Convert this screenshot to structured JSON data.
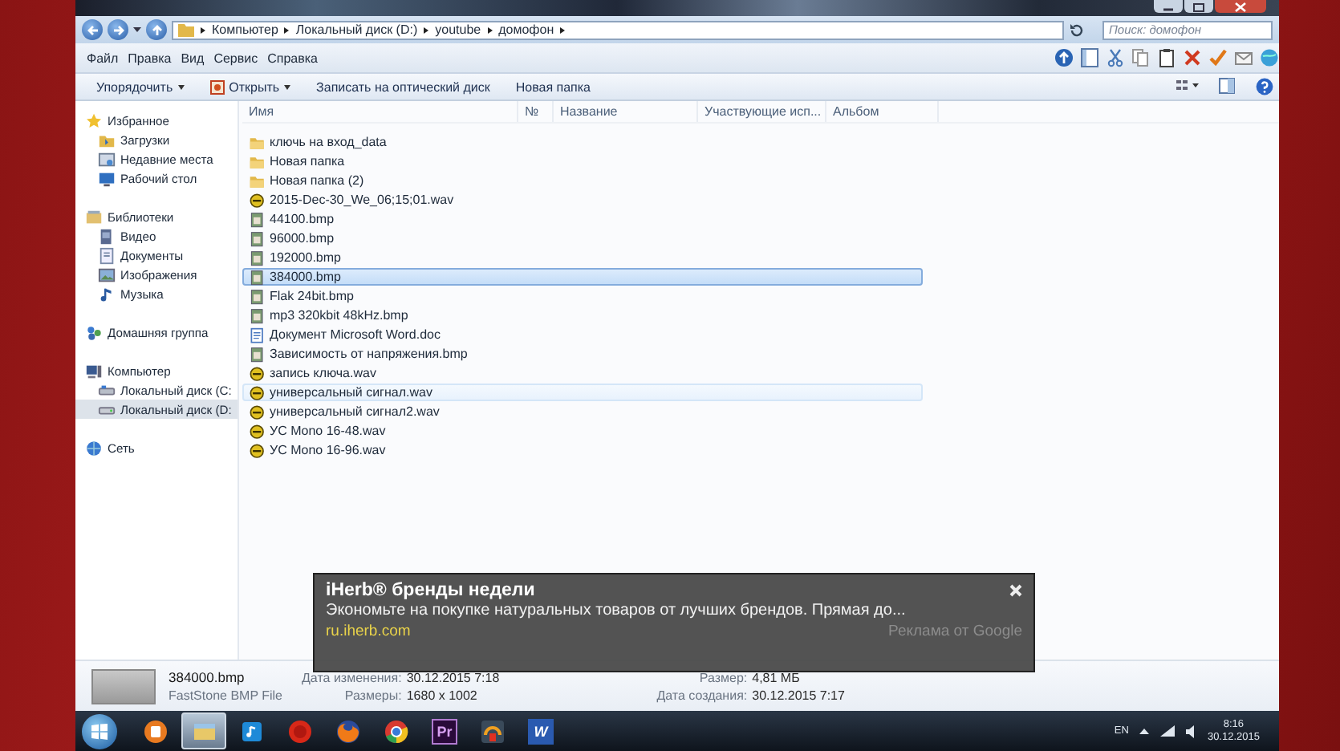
{
  "address_bar": {
    "path": [
      "Компьютер",
      "Локальный диск (D:)",
      "youtube",
      "домофон"
    ],
    "search": {
      "placeholder": "Поиск: домофон"
    }
  },
  "menu": [
    "Файл",
    "Правка",
    "Вид",
    "Сервис",
    "Справка"
  ],
  "toolbar": [
    {
      "label": "Упорядочить",
      "dropdown": true
    },
    {
      "label": "Открыть",
      "dropdown": true
    },
    {
      "label": "Записать на оптический диск",
      "dropdown": false
    },
    {
      "label": "Новая папка",
      "dropdown": false
    }
  ],
  "navigation": [
    {
      "label": "Избранное",
      "selected": false,
      "children": [
        {
          "label": "Загрузки",
          "selected": false
        },
        {
          "label": "Недавние места",
          "selected": false
        },
        {
          "label": "Рабочий стол",
          "selected": false
        }
      ]
    },
    {
      "label": "Библиотеки",
      "selected": false,
      "children": [
        {
          "label": "Видео",
          "selected": false
        },
        {
          "label": "Документы",
          "selected": false
        },
        {
          "label": "Изображения",
          "selected": false
        },
        {
          "label": "Музыка",
          "selected": false
        }
      ]
    },
    {
      "label": "Домашняя группа",
      "selected": false
    },
    {
      "label": "Компьютер",
      "selected": false,
      "children": [
        {
          "label": "Локальный диск (C:",
          "selected": false
        },
        {
          "label": "Локальный диск (D:",
          "selected": true
        }
      ]
    },
    {
      "label": "Сеть",
      "selected": false
    }
  ],
  "columns": [
    "Имя",
    "№",
    "Название",
    "Участвующие исп...",
    "Альбом"
  ],
  "files": [
    {
      "name": "ключь на вход_data",
      "kind": "folder",
      "selected": false,
      "hot": false
    },
    {
      "name": "Новая папка",
      "kind": "folder",
      "selected": false,
      "hot": false
    },
    {
      "name": "Новая папка (2)",
      "kind": "folder",
      "selected": false,
      "hot": false
    },
    {
      "name": "2015-Dec-30_We_06;15;01.wav",
      "kind": "wav",
      "selected": false,
      "hot": false
    },
    {
      "name": "44100.bmp",
      "kind": "bmp",
      "selected": false,
      "hot": false
    },
    {
      "name": "96000.bmp",
      "kind": "bmp",
      "selected": false,
      "hot": false
    },
    {
      "name": "192000.bmp",
      "kind": "bmp",
      "selected": false,
      "hot": false
    },
    {
      "name": "384000.bmp",
      "kind": "bmp",
      "selected": true,
      "hot": false
    },
    {
      "name": "Flak 24bit.bmp",
      "kind": "bmp",
      "selected": false,
      "hot": false
    },
    {
      "name": "mp3 320kbit 48kHz.bmp",
      "kind": "bmp",
      "selected": false,
      "hot": false
    },
    {
      "name": "Документ Microsoft Word.doc",
      "kind": "doc",
      "selected": false,
      "hot": false
    },
    {
      "name": "Зависимость от напряжения.bmp",
      "kind": "bmp",
      "selected": false,
      "hot": false
    },
    {
      "name": "запись ключа.wav",
      "kind": "wav",
      "selected": false,
      "hot": false
    },
    {
      "name": "универсальный сигнал.wav",
      "kind": "wav",
      "selected": false,
      "hot": true
    },
    {
      "name": "универсальный сигнал2.wav",
      "kind": "wav",
      "selected": false,
      "hot": false
    },
    {
      "name": "УС Mono 16-48.wav",
      "kind": "wav",
      "selected": false,
      "hot": false
    },
    {
      "name": "УС Mono 16-96.wav",
      "kind": "wav",
      "selected": false,
      "hot": false
    }
  ],
  "details": {
    "name": "384000.bmp",
    "type": "FastStone BMP File",
    "fields": [
      {
        "label": "Дата изменения:",
        "value": "30.12.2015 7:18"
      },
      {
        "label": "Размеры:",
        "value": "1680 x 1002"
      },
      {
        "label": "Размер:",
        "value": "4,81 МБ"
      },
      {
        "label": "Дата создания:",
        "value": "30.12.2015 7:17"
      }
    ]
  },
  "ad": {
    "title": "iHerb® бренды недели",
    "text": "Экономьте на покупке натуральных товаров от лучших брендов. Прямая до...",
    "url": "ru.iherb.com",
    "attribution": "Реклама от Google"
  },
  "taskbar": {
    "apps": [
      {
        "kind": "media",
        "active": false
      },
      {
        "kind": "explorer",
        "active": true
      },
      {
        "kind": "music",
        "active": false
      },
      {
        "kind": "red",
        "active": false
      },
      {
        "kind": "firefox",
        "active": false
      },
      {
        "kind": "chrome",
        "active": false
      },
      {
        "kind": "premiere",
        "active": false,
        "label": "Pr"
      },
      {
        "kind": "headphones",
        "active": false
      },
      {
        "kind": "word",
        "active": false,
        "label": "W"
      }
    ],
    "language": "EN",
    "time": "8:16",
    "date": "30.12.2015"
  }
}
